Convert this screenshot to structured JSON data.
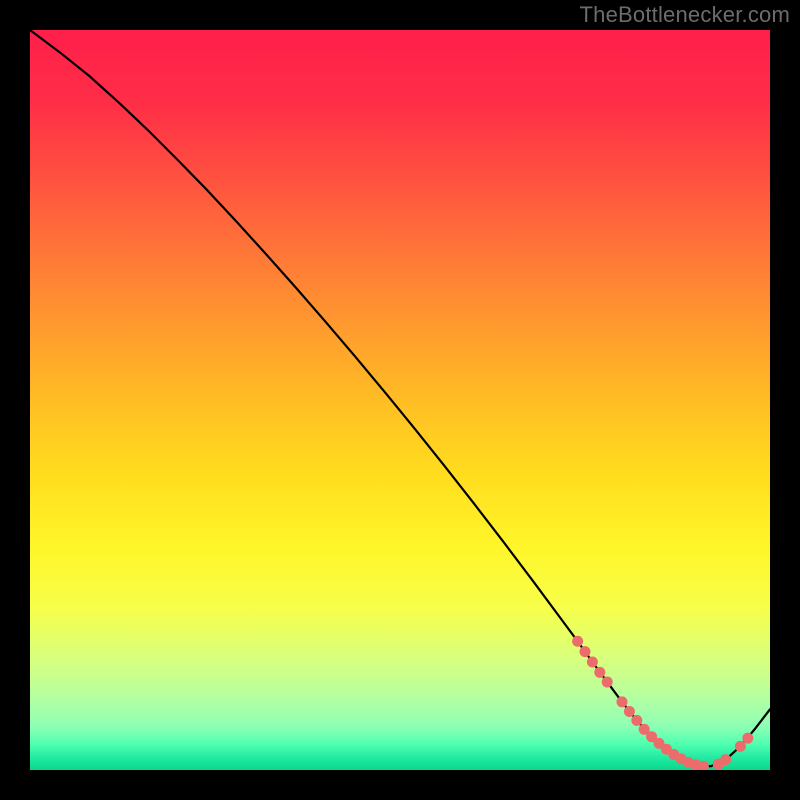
{
  "attribution": "TheBottlenecker.com",
  "chart_data": {
    "type": "line",
    "title": "",
    "xlabel": "",
    "ylabel": "",
    "xlim": [
      0,
      100
    ],
    "ylim": [
      0,
      100
    ],
    "grid": false,
    "legend": false,
    "background_gradient_stops": [
      {
        "offset": 0.0,
        "color": "#ff1f4a"
      },
      {
        "offset": 0.1,
        "color": "#ff2e47"
      },
      {
        "offset": 0.2,
        "color": "#ff5140"
      },
      {
        "offset": 0.3,
        "color": "#ff7638"
      },
      {
        "offset": 0.4,
        "color": "#ff9a2e"
      },
      {
        "offset": 0.5,
        "color": "#ffbd24"
      },
      {
        "offset": 0.6,
        "color": "#ffdd1e"
      },
      {
        "offset": 0.7,
        "color": "#fff62a"
      },
      {
        "offset": 0.78,
        "color": "#f7ff4a"
      },
      {
        "offset": 0.85,
        "color": "#d8ff7d"
      },
      {
        "offset": 0.9,
        "color": "#b6ffa0"
      },
      {
        "offset": 0.94,
        "color": "#8fffb4"
      },
      {
        "offset": 0.965,
        "color": "#4fffb0"
      },
      {
        "offset": 0.985,
        "color": "#1de9a0"
      },
      {
        "offset": 1.0,
        "color": "#0dd68a"
      }
    ],
    "series": [
      {
        "name": "bottleneck-curve",
        "color": "#000000",
        "width": 2.2,
        "x": [
          0,
          4,
          8,
          12,
          16,
          20,
          24,
          28,
          32,
          36,
          40,
          44,
          48,
          52,
          56,
          60,
          64,
          68,
          72,
          74,
          76,
          78,
          80,
          82,
          84,
          86,
          88,
          90,
          92,
          94,
          96,
          98,
          100
        ],
        "y": [
          100,
          97,
          93.8,
          90.2,
          86.4,
          82.4,
          78.3,
          74.0,
          69.6,
          65.1,
          60.5,
          55.8,
          51.0,
          46.1,
          41.1,
          36.0,
          30.8,
          25.5,
          20.1,
          17.4,
          14.6,
          11.9,
          9.2,
          6.7,
          4.5,
          2.8,
          1.5,
          0.7,
          0.5,
          1.4,
          3.2,
          5.6,
          8.2
        ]
      }
    ],
    "markers": {
      "name": "highlight-dots",
      "color": "#ec6b6b",
      "radius": 5.5,
      "points": [
        {
          "x": 74,
          "y": 17.4
        },
        {
          "x": 75,
          "y": 16.0
        },
        {
          "x": 76,
          "y": 14.6
        },
        {
          "x": 77,
          "y": 13.2
        },
        {
          "x": 78,
          "y": 11.9
        },
        {
          "x": 80,
          "y": 9.2
        },
        {
          "x": 81,
          "y": 7.9
        },
        {
          "x": 82,
          "y": 6.7
        },
        {
          "x": 83,
          "y": 5.5
        },
        {
          "x": 84,
          "y": 4.5
        },
        {
          "x": 85,
          "y": 3.6
        },
        {
          "x": 86,
          "y": 2.8
        },
        {
          "x": 87,
          "y": 2.1
        },
        {
          "x": 88,
          "y": 1.5
        },
        {
          "x": 89,
          "y": 1.0
        },
        {
          "x": 90,
          "y": 0.7
        },
        {
          "x": 91,
          "y": 0.5
        },
        {
          "x": 93,
          "y": 0.8
        },
        {
          "x": 94,
          "y": 1.4
        },
        {
          "x": 96,
          "y": 3.2
        },
        {
          "x": 97,
          "y": 4.3
        }
      ]
    }
  }
}
